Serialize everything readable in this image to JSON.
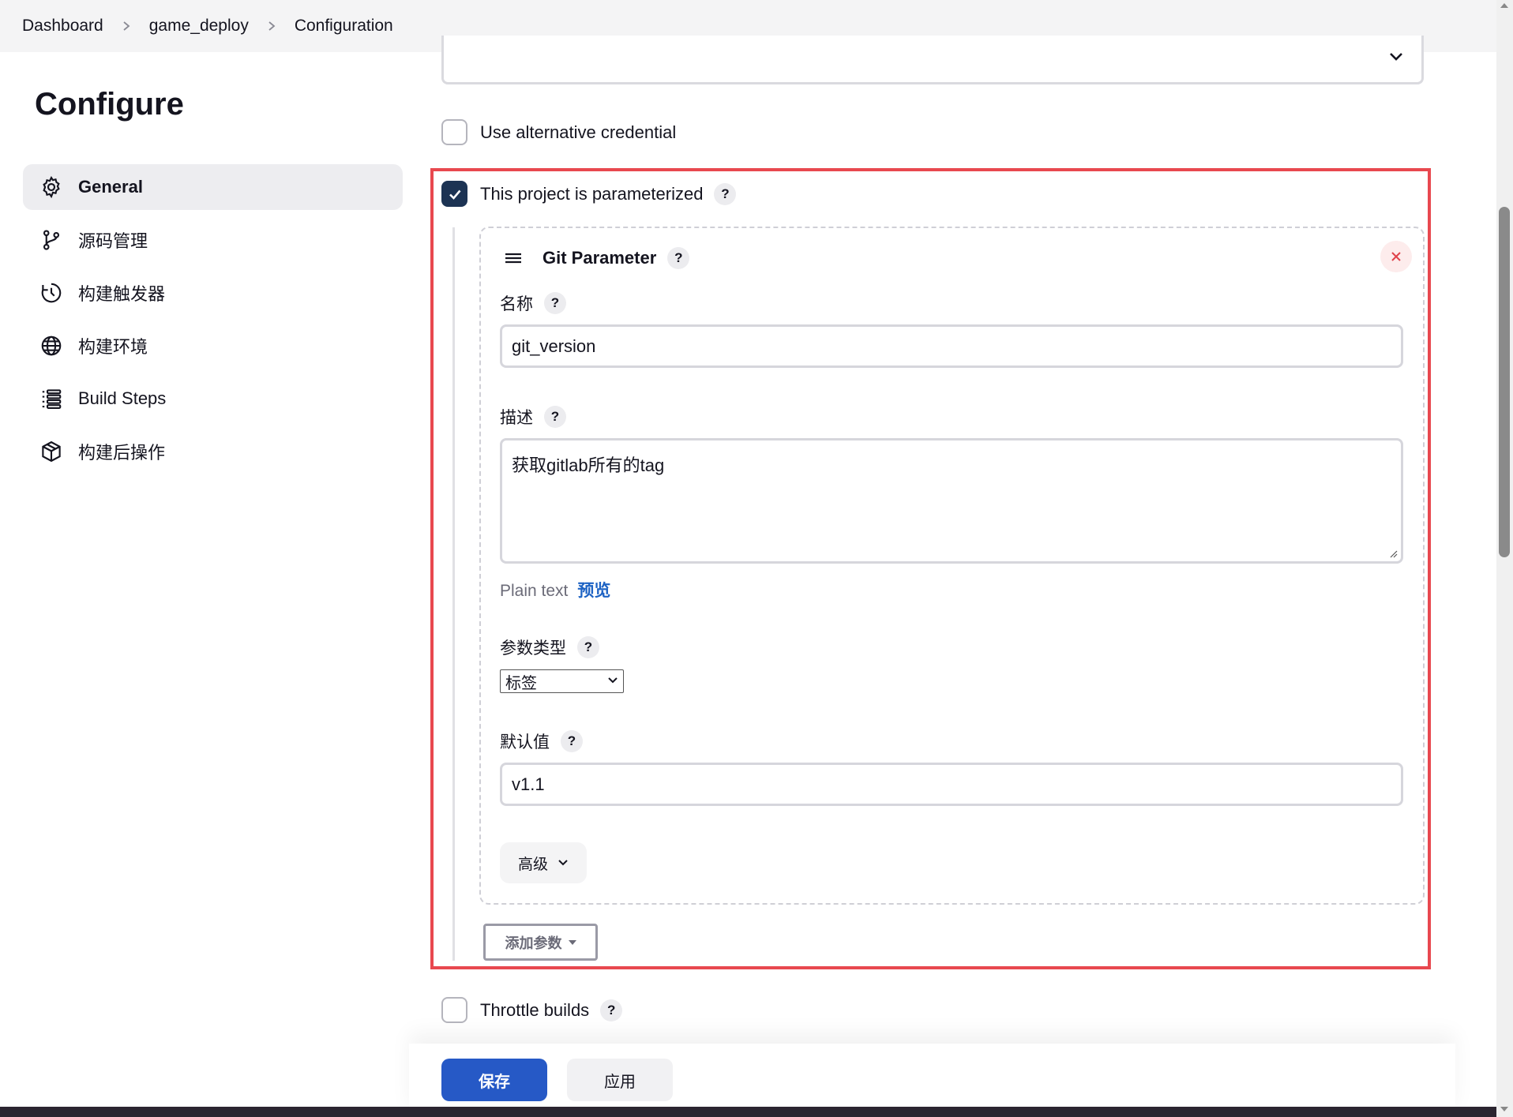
{
  "breadcrumb": {
    "items": [
      "Dashboard",
      "game_deploy",
      "Configuration"
    ]
  },
  "sidebar": {
    "title": "Configure",
    "items": [
      {
        "label": "General",
        "icon": "gear-icon",
        "active": true
      },
      {
        "label": "源码管理",
        "icon": "git-branch-icon",
        "active": false
      },
      {
        "label": "构建触发器",
        "icon": "clock-icon",
        "active": false
      },
      {
        "label": "构建环境",
        "icon": "globe-icon",
        "active": false
      },
      {
        "label": "Build Steps",
        "icon": "list-icon",
        "active": false
      },
      {
        "label": "构建后操作",
        "icon": "package-icon",
        "active": false
      }
    ]
  },
  "options": {
    "alt_credential": {
      "label": "Use alternative credential",
      "checked": false
    },
    "parameterized": {
      "label": "This project is parameterized",
      "checked": true,
      "help": "?"
    },
    "throttle": {
      "label": "Throttle builds",
      "checked": false,
      "help": "?"
    }
  },
  "git_parameter": {
    "title": "Git Parameter",
    "help": "?",
    "name": {
      "label": "名称",
      "value": "git_version"
    },
    "description": {
      "label": "描述",
      "value": "获取gitlab所有的tag"
    },
    "format": {
      "plain": "Plain text",
      "preview": "预览"
    },
    "type": {
      "label": "参数类型",
      "selected": "标签"
    },
    "default": {
      "label": "默认值",
      "value": "v1.1"
    },
    "advanced": "高级"
  },
  "add_parameter": "添加参数",
  "actions": {
    "save": "保存",
    "apply": "应用"
  },
  "colors": {
    "accent": "#2659c6",
    "checkbox_checked": "#1c3353",
    "highlight": "#e8484f",
    "link": "#1e63c4"
  }
}
